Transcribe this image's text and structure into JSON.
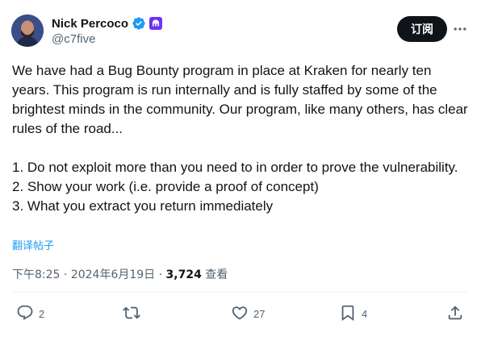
{
  "author": {
    "name": "Nick Percoco",
    "handle": "@c7five"
  },
  "header": {
    "subscribe_label": "订阅"
  },
  "post": {
    "paragraph1": "We have had a Bug Bounty program in place at Kraken for nearly ten years. This program is run internally and is fully staffed by some of the brightest minds in the community. Our program, like many others, has clear rules of the road...",
    "item1": "1. Do not exploit more than you need to in order to prove the vulnerability.",
    "item2": "2. Show your work (i.e. provide a proof of concept)",
    "item3": "3. What you extract you return immediately",
    "translate_label": "翻译帖子"
  },
  "meta": {
    "time": "下午8:25",
    "separator1": " · ",
    "date": "2024年6月19日",
    "separator2": " · ",
    "views": "3,724",
    "views_label": " 查看"
  },
  "actions": {
    "replies": "2",
    "reposts": "",
    "likes": "27",
    "bookmarks": "4"
  },
  "colors": {
    "text": "#0f1419",
    "secondary": "#536471",
    "link": "#1d9bf0",
    "verified": "#1d9bf0",
    "org_badge": "#7132f5"
  },
  "icons": [
    "verified-badge-icon",
    "kraken-org-icon",
    "more-icon",
    "reply-icon",
    "repost-icon",
    "like-icon",
    "bookmark-icon",
    "share-icon"
  ]
}
